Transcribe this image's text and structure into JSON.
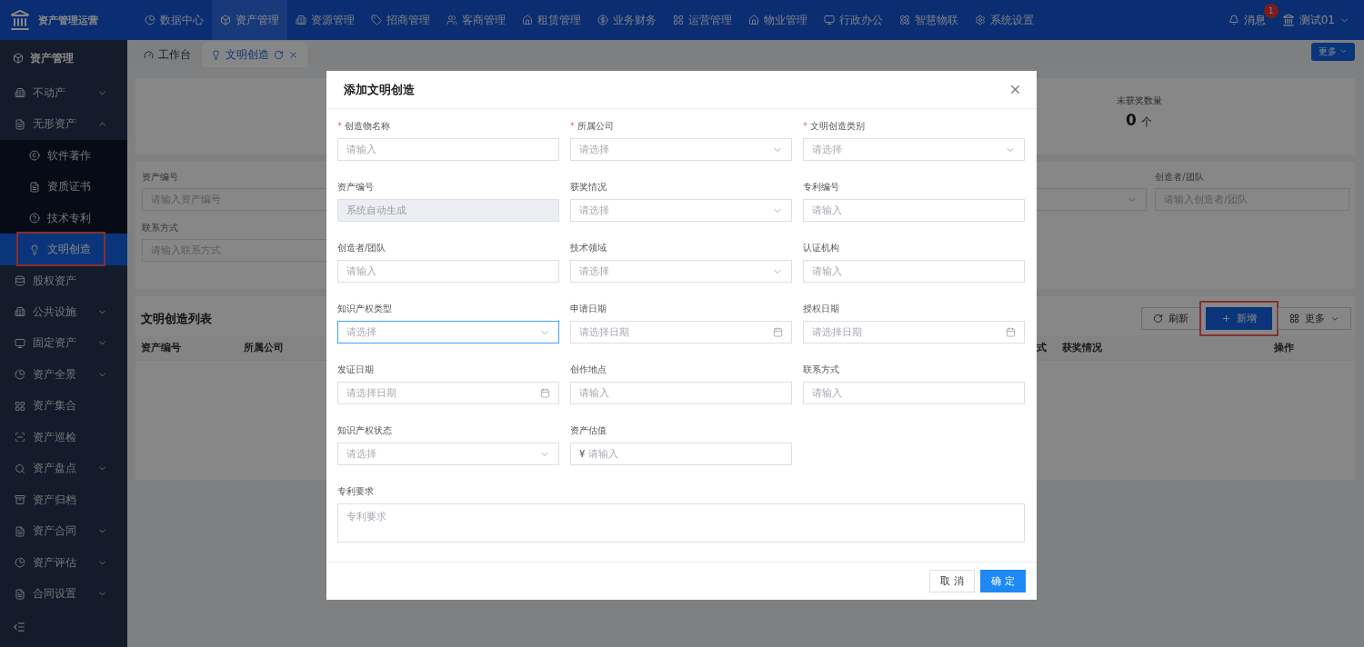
{
  "topbar": {
    "brand": "资产管理运营",
    "nav": [
      {
        "label": "数据中心",
        "selected": false
      },
      {
        "label": "资产管理",
        "selected": true
      },
      {
        "label": "资源管理",
        "selected": false
      },
      {
        "label": "招商管理",
        "selected": false
      },
      {
        "label": "客商管理",
        "selected": false
      },
      {
        "label": "租赁管理",
        "selected": false
      },
      {
        "label": "业务财务",
        "selected": false
      },
      {
        "label": "运营管理",
        "selected": false
      },
      {
        "label": "物业管理",
        "selected": false
      },
      {
        "label": "行政办公",
        "selected": false
      },
      {
        "label": "智慧物联",
        "selected": false
      },
      {
        "label": "系统设置",
        "selected": false
      }
    ],
    "messages": {
      "label": "消息",
      "badge": "1"
    },
    "user": "测试01"
  },
  "sidebar": {
    "title": "资产管理",
    "items": [
      {
        "label": "不动产",
        "expanded": false,
        "selected": false,
        "highlighted": false
      },
      {
        "label": "无形资产",
        "expanded": true,
        "selected": false,
        "highlighted": false,
        "children": [
          {
            "label": "软件著作",
            "selected": false,
            "highlighted": false
          },
          {
            "label": "资质证书",
            "selected": false,
            "highlighted": false
          },
          {
            "label": "技术专利",
            "selected": false,
            "highlighted": false
          },
          {
            "label": "文明创造",
            "selected": true,
            "highlighted": true
          }
        ]
      },
      {
        "label": "股权资产",
        "selected": false,
        "highlighted": false
      },
      {
        "label": "公共设施",
        "expanded": false,
        "selected": false,
        "highlighted": false
      },
      {
        "label": "固定资产",
        "expanded": false,
        "selected": false,
        "highlighted": false
      },
      {
        "label": "资产全景",
        "expanded": false,
        "selected": false,
        "highlighted": false
      },
      {
        "label": "资产集合",
        "selected": false,
        "highlighted": false
      },
      {
        "label": "资产巡检",
        "selected": false,
        "highlighted": false
      },
      {
        "label": "资产盘点",
        "expanded": false,
        "selected": false,
        "highlighted": false
      },
      {
        "label": "资产归档",
        "selected": false,
        "highlighted": false
      },
      {
        "label": "资产合同",
        "expanded": false,
        "selected": false,
        "highlighted": false
      },
      {
        "label": "资产评估",
        "expanded": false,
        "selected": false,
        "highlighted": false
      },
      {
        "label": "合同设置",
        "expanded": false,
        "selected": false,
        "highlighted": false
      }
    ]
  },
  "tabs": [
    {
      "label": "工作台",
      "selected": false,
      "closable": false
    },
    {
      "label": "文明创造",
      "selected": true,
      "closable": true
    }
  ],
  "tabs_more": "更多",
  "stats": [
    {
      "label": "未获奖数量",
      "value": "0",
      "unit": "个"
    }
  ],
  "filters": [
    {
      "label": "资产编号",
      "placeholder": "请输入资产编号",
      "kind": "input"
    },
    {
      "kind": "select"
    },
    {
      "label": "创造者/团队",
      "placeholder": "请输入创造者/团队",
      "kind": "input"
    },
    {
      "label": "联系方式",
      "placeholder": "请输入联系方式",
      "kind": "input"
    }
  ],
  "table": {
    "title": "文明创造列表",
    "buttons": [
      {
        "label": "刷新",
        "kind": "refresh",
        "highlighted": false
      },
      {
        "label": "新增",
        "kind": "add",
        "highlighted": true
      },
      {
        "label": "更多",
        "kind": "more",
        "highlighted": false
      }
    ],
    "columns": [
      "资产编号",
      "所属公司",
      "式",
      "获奖情况",
      "操作"
    ]
  },
  "dialog": {
    "title": "添加文明创造",
    "fields": [
      {
        "label": "创造物名称",
        "required_mark": "*",
        "kind": "input",
        "placeholder": "请输入",
        "focused": false,
        "disabled": false
      },
      {
        "label": "所属公司",
        "required_mark": "*",
        "kind": "select",
        "placeholder": "请选择",
        "focused": false,
        "disabled": false
      },
      {
        "label": "文明创造类别",
        "required_mark": "*",
        "kind": "select",
        "placeholder": "请选择",
        "focused": false,
        "disabled": false
      },
      {
        "label": "资产编号",
        "kind": "input",
        "placeholder": "系统自动生成",
        "focused": false,
        "disabled": true
      },
      {
        "label": "获奖情况",
        "kind": "select",
        "placeholder": "请选择",
        "focused": false,
        "disabled": false
      },
      {
        "label": "专利编号",
        "kind": "input",
        "placeholder": "请输入",
        "focused": false,
        "disabled": false
      },
      {
        "label": "创造者/团队",
        "kind": "input",
        "placeholder": "请输入",
        "focused": false,
        "disabled": false
      },
      {
        "label": "技术领域",
        "kind": "select",
        "placeholder": "请选择",
        "focused": false,
        "disabled": false
      },
      {
        "label": "认证机构",
        "kind": "input",
        "placeholder": "请输入",
        "focused": false,
        "disabled": false
      },
      {
        "label": "知识产权类型",
        "kind": "select",
        "placeholder": "请选择",
        "focused": true,
        "disabled": false
      },
      {
        "label": "申请日期",
        "kind": "date",
        "placeholder": "请选择日期",
        "focused": false,
        "disabled": false
      },
      {
        "label": "授权日期",
        "kind": "date",
        "placeholder": "请选择日期",
        "focused": false,
        "disabled": false
      },
      {
        "label": "发证日期",
        "kind": "date",
        "placeholder": "请选择日期",
        "focused": false,
        "disabled": false
      },
      {
        "label": "创作地点",
        "kind": "input",
        "placeholder": "请输入",
        "focused": false,
        "disabled": false
      },
      {
        "label": "联系方式",
        "kind": "input",
        "placeholder": "请输入",
        "focused": false,
        "disabled": false
      },
      {
        "label": "知识产权状态",
        "kind": "select",
        "placeholder": "请选择",
        "focused": false,
        "disabled": false
      },
      {
        "label": "资产估值",
        "kind": "money",
        "prefix": "¥",
        "placeholder": "请输入",
        "focused": false,
        "disabled": false
      },
      {
        "label": "专利要求",
        "kind": "textarea",
        "placeholder": "专利要求",
        "focused": false,
        "disabled": false
      }
    ],
    "buttons": [
      {
        "label": "取 消",
        "kind": "secondary"
      },
      {
        "label": "确 定",
        "kind": "primary"
      }
    ]
  }
}
